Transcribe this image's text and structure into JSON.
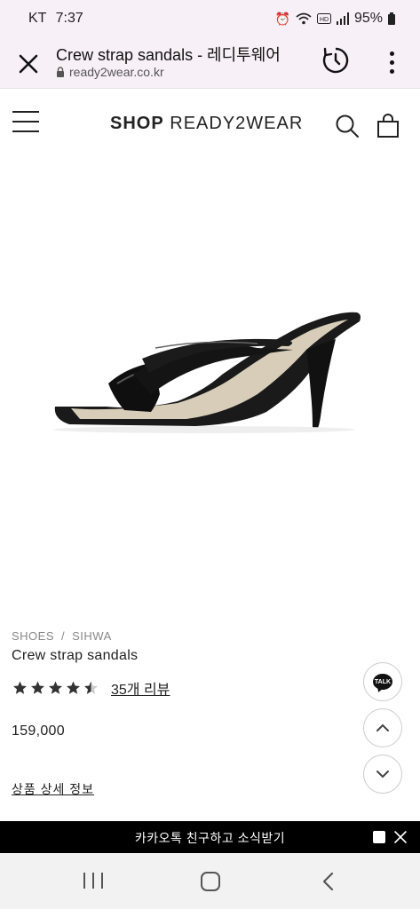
{
  "status_bar": {
    "carrier": "KT",
    "time": "7:37",
    "battery": "95%",
    "icons": [
      "alarm-icon",
      "wifi-icon",
      "hd-icon",
      "signal-icon",
      "battery-icon"
    ]
  },
  "browser": {
    "page_title": "Crew strap sandals - 레디투웨어",
    "url": "ready2wear.co.kr"
  },
  "header": {
    "logo_bold": "SHOP",
    "logo_light": "READY2WEAR"
  },
  "product": {
    "breadcrumb": [
      "SHOES",
      "SIHWA"
    ],
    "breadcrumb_separator": "/",
    "name": "Crew strap sandals",
    "rating": 4.5,
    "rating_max": 5,
    "review_link": "35개 리뷰",
    "price": "159,000",
    "detail_link": "상품 상세 정보"
  },
  "floating": {
    "talk_label": "TALK"
  },
  "kakao_banner": {
    "text": "카카오톡 친구하고 소식받기"
  },
  "colors": {
    "accent": "#000000",
    "chrome_bg": "#f7f0f7",
    "text": "#222222"
  }
}
